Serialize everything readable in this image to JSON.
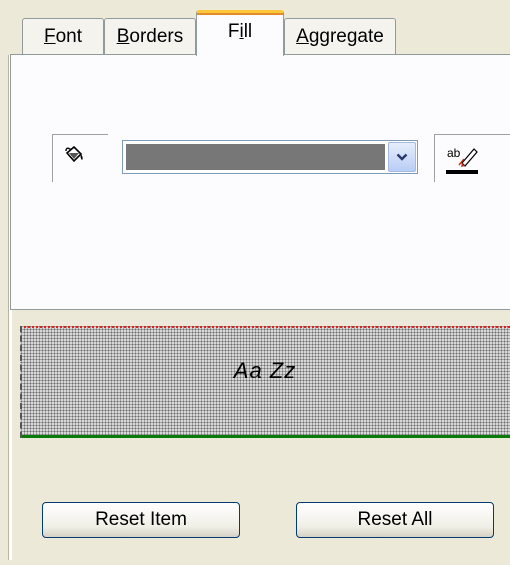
{
  "tabs": [
    {
      "label": "Font",
      "mnemonic": "F",
      "rest": "ont",
      "active": false
    },
    {
      "label": "Borders",
      "mnemonic": "B",
      "rest": "orders",
      "active": false
    },
    {
      "label": "Fill",
      "pre": "F",
      "mnemonic": "i",
      "rest": "ll",
      "active": true
    },
    {
      "label": "Aggregate",
      "mnemonic": "A",
      "rest": "ggregate",
      "active": false
    }
  ],
  "fill": {
    "icon": "paint-bucket-icon",
    "pattern_select_value": "dotted pattern",
    "color_icon": "text-color-icon",
    "color_underline": "#000000"
  },
  "preview": {
    "sample_text": "Aa Zz",
    "top_border_color": "#e02020",
    "bottom_border_color": "#0a7a0a"
  },
  "buttons": {
    "reset_item": "Reset Item",
    "reset_all": "Reset All"
  }
}
